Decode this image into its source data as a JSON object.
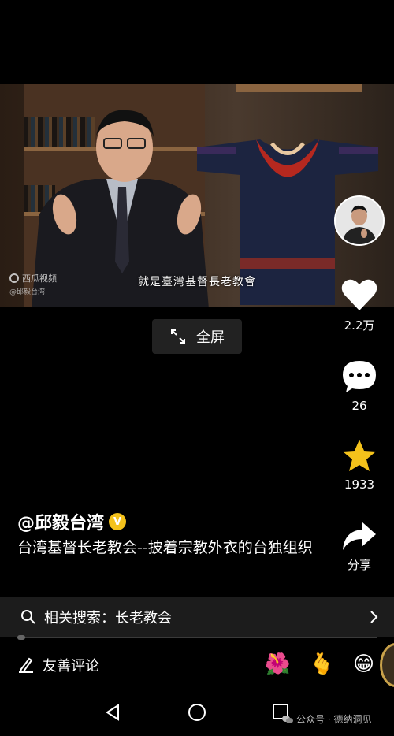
{
  "video": {
    "subtitle": "就是臺灣基督長老教會",
    "watermark_logo": "西瓜视频",
    "watermark_handle": "@邱毅台湾"
  },
  "fullscreen": {
    "label": "全屏",
    "icon": "expand-icon"
  },
  "actions": {
    "like_count": "2.2万",
    "comment_count": "26",
    "favorite_count": "1933",
    "share_label": "分享"
  },
  "post": {
    "author": "@邱毅台湾",
    "verified_badge": "V",
    "caption": "台湾基督长老教会--披着宗教外衣的台独组织"
  },
  "related_search": {
    "label": "相关搜索：长老教会"
  },
  "comment_bar": {
    "placeholder": "友善评论",
    "emojis": [
      "🌺",
      "🫰",
      "😁"
    ]
  },
  "system_overlay": {
    "wechat_watermark": "公众号 · 德纳洞见"
  },
  "colors": {
    "like": "#ffffff",
    "favorite": "#f4c21b",
    "verified": "#f4c21b",
    "background": "#000000"
  }
}
